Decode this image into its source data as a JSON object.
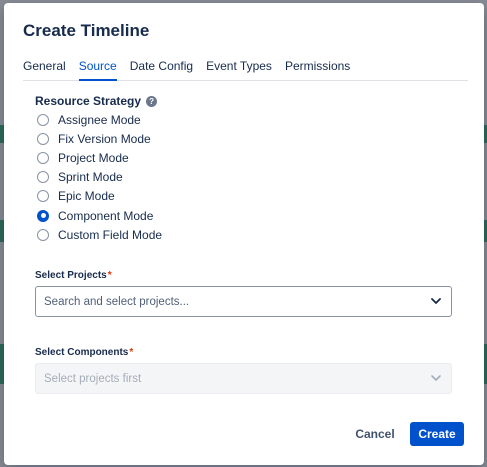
{
  "dialog": {
    "title": "Create Timeline"
  },
  "tabs": [
    {
      "label": "General",
      "active": false
    },
    {
      "label": "Source",
      "active": true
    },
    {
      "label": "Date Config",
      "active": false
    },
    {
      "label": "Event Types",
      "active": false
    },
    {
      "label": "Permissions",
      "active": false
    }
  ],
  "resource_strategy": {
    "label": "Resource Strategy",
    "help_icon": "question-circle-icon",
    "options": [
      {
        "label": "Assignee Mode",
        "checked": false
      },
      {
        "label": "Fix Version Mode",
        "checked": false
      },
      {
        "label": "Project Mode",
        "checked": false
      },
      {
        "label": "Sprint Mode",
        "checked": false
      },
      {
        "label": "Epic Mode",
        "checked": false
      },
      {
        "label": "Component Mode",
        "checked": true
      },
      {
        "label": "Custom Field Mode",
        "checked": false
      }
    ]
  },
  "select_projects": {
    "label": "Select Projects",
    "required_mark": "*",
    "placeholder": "Search and select projects..."
  },
  "select_components": {
    "label": "Select Components",
    "required_mark": "*",
    "placeholder": "Select projects first",
    "disabled": true
  },
  "footer": {
    "cancel_label": "Cancel",
    "create_label": "Create"
  },
  "colors": {
    "primary": "#0052cc",
    "text": "#172b4d",
    "required": "#de350b"
  }
}
